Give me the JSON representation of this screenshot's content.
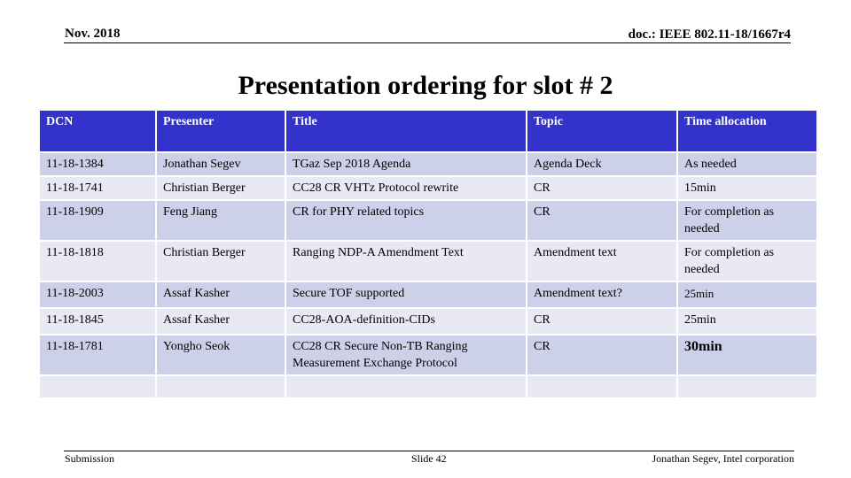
{
  "header": {
    "date": "Nov. 2018",
    "doc": "doc.: IEEE 802.11-18/1667r4"
  },
  "title": "Presentation ordering for slot # 2",
  "table": {
    "columns": [
      "DCN",
      "Presenter",
      "Title",
      "Topic",
      "Time allocation"
    ],
    "rows": [
      [
        "11-18-1384",
        "Jonathan Segev",
        "TGaz Sep 2018 Agenda",
        "Agenda Deck",
        "As needed"
      ],
      [
        "11-18-1741",
        "Christian Berger",
        "CC28 CR VHTz Protocol rewrite",
        "CR",
        "15min"
      ],
      [
        "11-18-1909",
        "Feng Jiang",
        "CR for PHY related topics",
        "CR",
        "For completion as needed"
      ],
      [
        "11-18-1818",
        "Christian Berger",
        "Ranging NDP-A Amendment Text",
        "Amendment text",
        "For completion as needed"
      ],
      [
        "11-18-2003",
        "Assaf Kasher",
        "Secure TOF supported",
        "Amendment text?",
        "25min"
      ],
      [
        "11-18-1845",
        "Assaf Kasher",
        "CC28-AOA-definition-CIDs",
        "CR",
        "25min"
      ],
      [
        "11-18-1781",
        "Yongho Seok",
        "CC28 CR Secure Non-TB Ranging Measurement Exchange Protocol",
        "CR",
        "30min"
      ],
      [
        "",
        "",
        "",
        "",
        ""
      ]
    ]
  },
  "footer": {
    "left": "Submission",
    "center": "Slide 42",
    "right": "Jonathan Segev, Intel corporation"
  }
}
